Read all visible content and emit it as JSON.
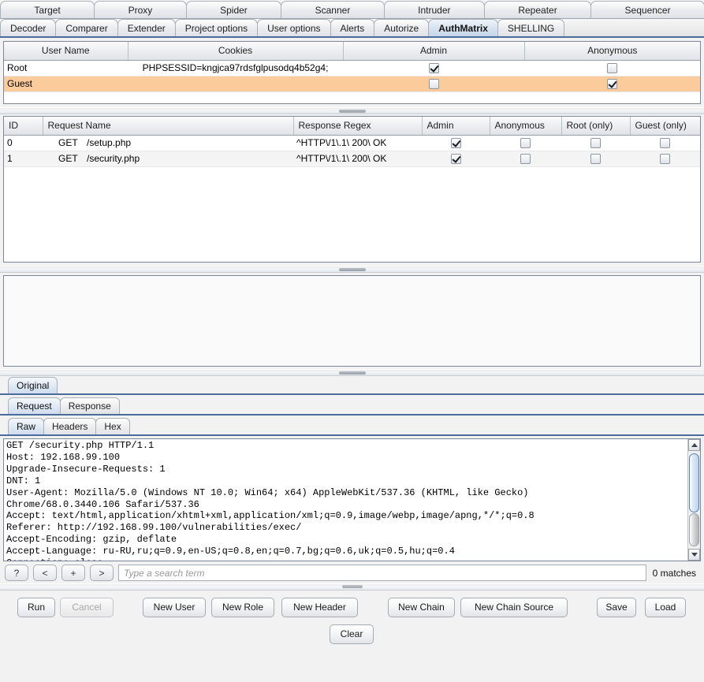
{
  "window": {
    "suite_tabs_row1": [
      "Target",
      "Proxy",
      "Spider",
      "Scanner",
      "Intruder",
      "Repeater",
      "Sequencer"
    ],
    "suite_tabs_row2": [
      "Decoder",
      "Comparer",
      "Extender",
      "Project options",
      "User options",
      "Alerts",
      "Autorize",
      "AuthMatrix",
      "SHELLING"
    ],
    "selected_tab": "AuthMatrix"
  },
  "users_table": {
    "columns": [
      "User Name",
      "Cookies",
      "Admin",
      "Anonymous"
    ],
    "rows": [
      {
        "name": "Root",
        "cookies": "PHPSESSID=kngjca97rdsfglpusodq4b52g4;",
        "admin": true,
        "anonymous": false,
        "selected": false
      },
      {
        "name": "Guest",
        "cookies": "",
        "admin": false,
        "anonymous": true,
        "selected": true
      }
    ]
  },
  "requests_table": {
    "columns": [
      "ID",
      "Request Name",
      "Response Regex",
      "Admin",
      "Anonymous",
      "Root (only)",
      "Guest (only)"
    ],
    "rows": [
      {
        "id": "0",
        "method": "GET",
        "path": "/setup.php",
        "regex": "^HTTP\\/1\\.1\\ 200\\ OK",
        "admin": true,
        "anonymous": false,
        "root_only": false,
        "guest_only": false
      },
      {
        "id": "1",
        "method": "GET",
        "path": "/security.php",
        "regex": "^HTTP\\/1\\.1\\ 200\\ OK",
        "admin": true,
        "anonymous": false,
        "root_only": false,
        "guest_only": false
      }
    ]
  },
  "message_viewer": {
    "chain_tabs": [
      "Original"
    ],
    "chain_selected": "Original",
    "msg_tabs": [
      "Request",
      "Response"
    ],
    "msg_selected": "Request",
    "view_tabs": [
      "Raw",
      "Headers",
      "Hex"
    ],
    "view_selected": "Raw",
    "raw_text": "GET /security.php HTTP/1.1\nHost: 192.168.99.100\nUpgrade-Insecure-Requests: 1\nDNT: 1\nUser-Agent: Mozilla/5.0 (Windows NT 10.0; Win64; x64) AppleWebKit/537.36 (KHTML, like Gecko)\nChrome/68.0.3440.106 Safari/537.36\nAccept: text/html,application/xhtml+xml,application/xml;q=0.9,image/webp,image/apng,*/*;q=0.8\nReferer: http://192.168.99.100/vulnerabilities/exec/\nAccept-Encoding: gzip, deflate\nAccept-Language: ru-RU,ru;q=0.9,en-US;q=0.8,en;q=0.7,bg;q=0.6,uk;q=0.5,hu;q=0.4\nConnection: close"
  },
  "search": {
    "help_label": "?",
    "prev_label": "<",
    "add_label": "+",
    "next_label": ">",
    "value": "",
    "placeholder": "Type a search term",
    "matches": "0 matches"
  },
  "actions": {
    "run": "Run",
    "cancel": "Cancel",
    "new_user": "New User",
    "new_role": "New Role",
    "new_header": "New Header",
    "new_chain": "New Chain",
    "new_chain_source": "New Chain Source",
    "save": "Save",
    "load": "Load",
    "clear": "Clear"
  },
  "colors": {
    "selected_row": "#fbcb9c",
    "tab_selected": "#cfdcee",
    "accent_border": "#4a6d9c"
  }
}
